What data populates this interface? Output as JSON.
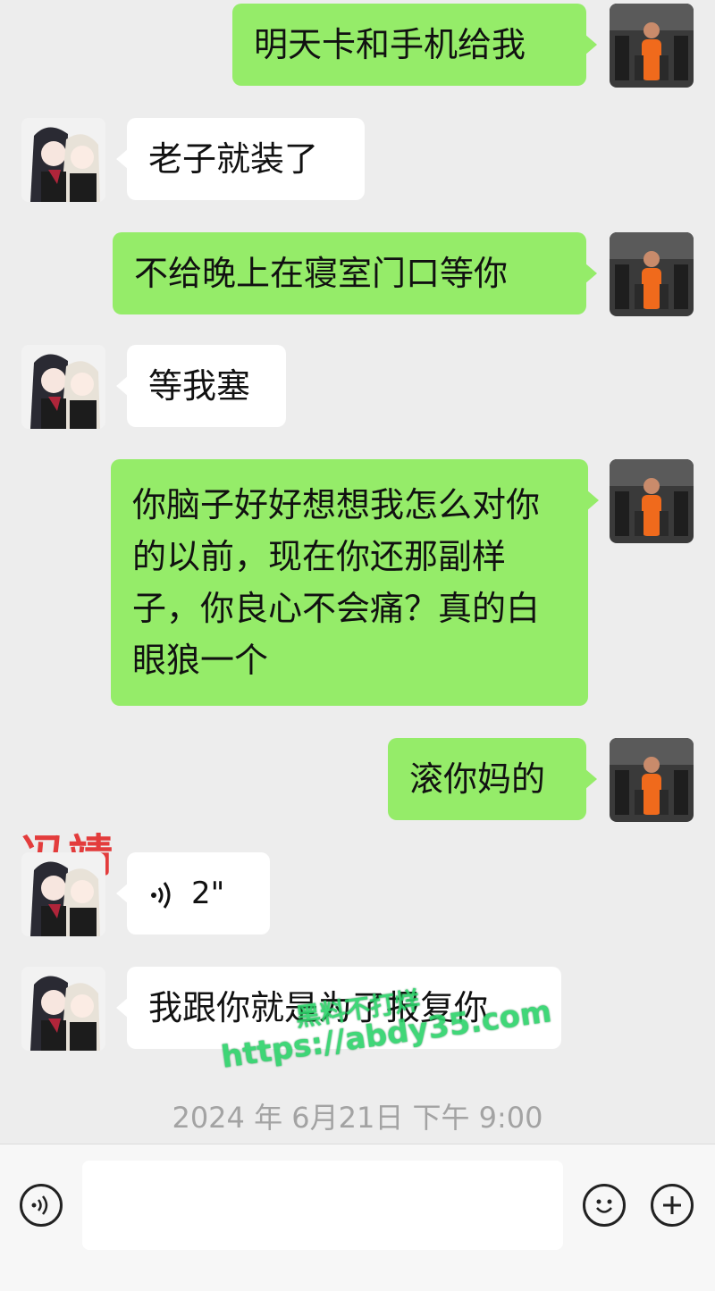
{
  "messages": [
    {
      "side": "me",
      "text": "明天卡和手机给我"
    },
    {
      "side": "them",
      "text": "老子就装了"
    },
    {
      "side": "me",
      "text": "不给晚上在寝室门口等你"
    },
    {
      "side": "them",
      "text": "等我塞"
    },
    {
      "side": "me",
      "text": "你脑子好好想想我怎么对你的以前，现在你还那副样子，你良心不会痛？真的白眼狼一个"
    },
    {
      "side": "me",
      "text": "滚你妈的"
    },
    {
      "side": "them",
      "type": "voice",
      "duration": "2\""
    },
    {
      "side": "them",
      "text": "我跟你就是为了报复你"
    }
  ],
  "name_tag": "冯靖",
  "timestamp": "2024 年 6月21日 下午 9:00",
  "watermarks": [
    "黑料不打烊",
    "https://abdy35.com"
  ],
  "input_bar": {
    "voice_button_icon": "voice-icon",
    "emoji_button_icon": "emoji-icon",
    "add_button_icon": "plus-icon"
  },
  "colors": {
    "my_bubble": "#95ec69",
    "their_bubble": "#ffffff",
    "background": "#ededed",
    "name_tag": "#e33c3c"
  }
}
